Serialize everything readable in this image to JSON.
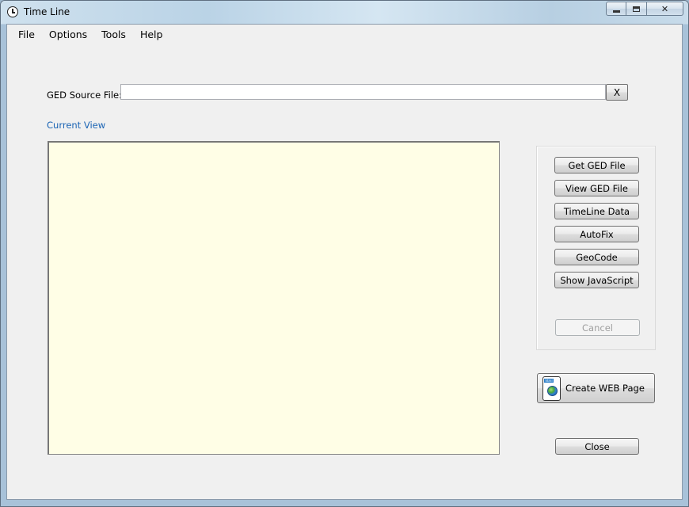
{
  "window": {
    "title": "Time Line",
    "controls": {
      "minimize": "minimize",
      "maximize": "maximize",
      "close": "✕"
    }
  },
  "menu": [
    {
      "label": "File"
    },
    {
      "label": "Options"
    },
    {
      "label": "Tools"
    },
    {
      "label": "Help"
    }
  ],
  "source": {
    "label": "GED Source File:",
    "value": "",
    "clear_label": "X"
  },
  "view": {
    "label": "Current View",
    "background": "#fffee6"
  },
  "actions": {
    "get_ged": "Get GED File",
    "view_ged": "View GED File",
    "timeline_data": "TimeLine Data",
    "autofix": "AutoFix",
    "geocode": "GeoCode",
    "show_js": "Show JavaScript",
    "cancel": "Cancel"
  },
  "web": {
    "label": "Create WEB Page",
    "icon_tag": "html"
  },
  "close_label": "Close",
  "colors": {
    "link": "#1a64b4",
    "panel": "#f0f0f0"
  },
  "icons": {
    "app": "clock-icon",
    "web": "html-globe-icon"
  }
}
